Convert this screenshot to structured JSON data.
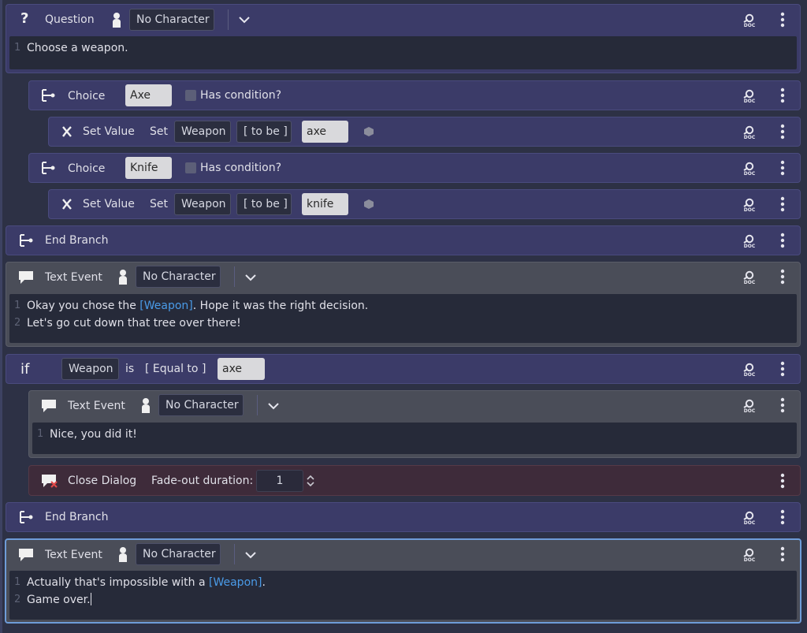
{
  "common": {
    "doc_icon_text": "DOC",
    "expand_icon": "chevron-down-icon"
  },
  "question": {
    "title": "Question",
    "character": "No Character",
    "text_lines": [
      "Choose a weapon."
    ],
    "line_numbers": [
      "1"
    ]
  },
  "choice_axe": {
    "title": "Choice",
    "value": "Axe",
    "condition_label": "Has condition?"
  },
  "set_axe": {
    "title": "Set Value",
    "set_label": "Set",
    "variable": "Weapon",
    "operation": "[ to be ]",
    "value": "axe"
  },
  "choice_knife": {
    "title": "Choice",
    "value": "Knife",
    "condition_label": "Has condition?"
  },
  "set_knife": {
    "title": "Set Value",
    "set_label": "Set",
    "variable": "Weapon",
    "operation": "[ to be ]",
    "value": "knife"
  },
  "end_branch_1": {
    "title": "End Branch"
  },
  "text_event_1": {
    "title": "Text Event",
    "character": "No Character",
    "line1_before": "Okay you chose the ",
    "line1_var": "[Weapon]",
    "line1_after": ". Hope it was the right decision.",
    "line2": "Let's go cut down that tree over there!",
    "ln1": "1",
    "ln2": "2"
  },
  "condition": {
    "keyword": "if",
    "variable": "Weapon",
    "is_label": "is",
    "operator": "[ Equal to ]",
    "value": "axe"
  },
  "text_event_2": {
    "title": "Text Event",
    "character": "No Character",
    "line1": "Nice, you did it!",
    "ln1": "1"
  },
  "close_dialog": {
    "title": "Close Dialog",
    "fade_label": "Fade-out duration:",
    "fade_value": "1"
  },
  "end_branch_2": {
    "title": "End Branch"
  },
  "text_event_3": {
    "title": "Text Event",
    "character": "No Character",
    "line1_before": "Actually that's impossible with a ",
    "line1_var": "[Weapon]",
    "line1_after": ".",
    "line2": "Game over.",
    "ln1": "1",
    "ln2": "2"
  }
}
